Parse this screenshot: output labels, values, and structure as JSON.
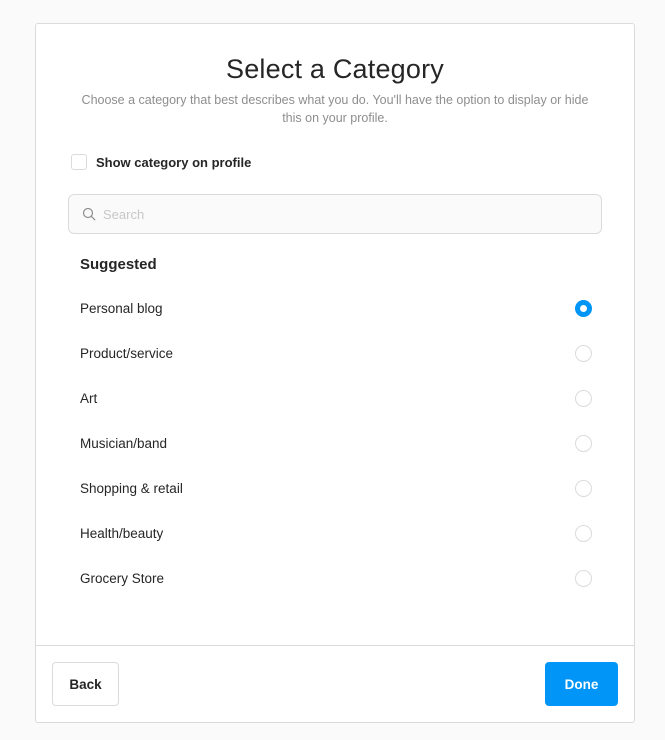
{
  "header": {
    "title": "Select a Category",
    "subtitle": "Choose a category that best describes what you do. You'll have the option to display or hide this on your profile."
  },
  "show_category": {
    "label": "Show category on profile",
    "checked": false
  },
  "search": {
    "placeholder": "Search",
    "value": "",
    "icon": "search-icon"
  },
  "suggested": {
    "heading": "Suggested",
    "items": [
      {
        "label": "Personal blog",
        "selected": true
      },
      {
        "label": "Product/service",
        "selected": false
      },
      {
        "label": "Art",
        "selected": false
      },
      {
        "label": "Musician/band",
        "selected": false
      },
      {
        "label": "Shopping & retail",
        "selected": false
      },
      {
        "label": "Health/beauty",
        "selected": false
      },
      {
        "label": "Grocery Store",
        "selected": false
      }
    ]
  },
  "footer": {
    "back_label": "Back",
    "done_label": "Done"
  },
  "colors": {
    "accent": "#0095f6",
    "border": "#dbdbdb",
    "muted_text": "#8e8e8e",
    "text": "#262626",
    "background": "#fafafa"
  }
}
